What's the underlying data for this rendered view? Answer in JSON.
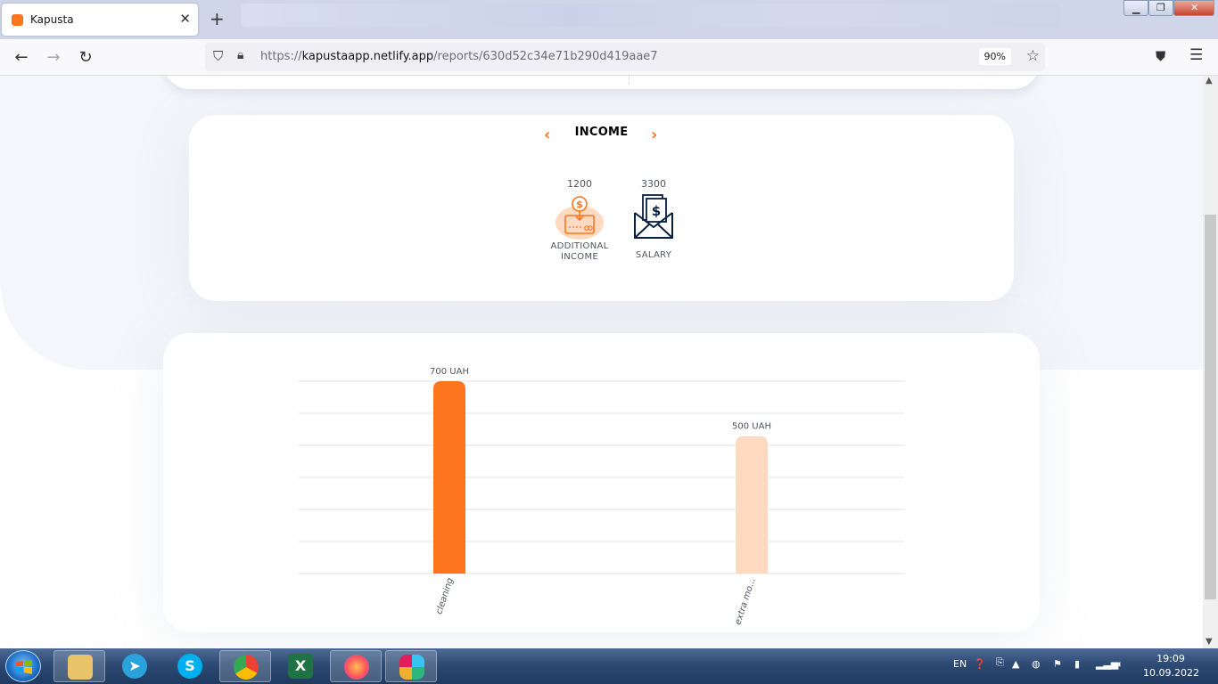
{
  "browser": {
    "tab_title": "Kapusta",
    "tab_close": "✕",
    "new_tab": "+",
    "url_prefix": "https://",
    "url_domain": "kapustaapp.netlify.app",
    "url_path": "/reports/630d52c34e71b290d419aae7",
    "zoom": "90%"
  },
  "income": {
    "heading": "INCOME",
    "prev_arrow": "‹",
    "next_arrow": "›",
    "categories": [
      {
        "amount": "1200",
        "label_line1": "ADDITIONAL",
        "label_line2": "INCOME",
        "icon": "additional-income-icon",
        "selected": true
      },
      {
        "amount": "3300",
        "label_line1": "SALARY",
        "label_line2": "",
        "icon": "salary-icon",
        "selected": false
      }
    ]
  },
  "chart_data": {
    "type": "bar",
    "categories": [
      "cleaning",
      "extra mo..."
    ],
    "values": [
      700,
      500
    ],
    "value_labels": [
      "700 UAH",
      "500 UAH"
    ],
    "colors": [
      "#ff751d",
      "#ffdac0"
    ],
    "ylim": [
      0,
      700
    ],
    "grid": true,
    "gridlines": 7
  },
  "taskbar": {
    "lang": "EN",
    "time": "19:09",
    "date": "10.09.2022"
  }
}
